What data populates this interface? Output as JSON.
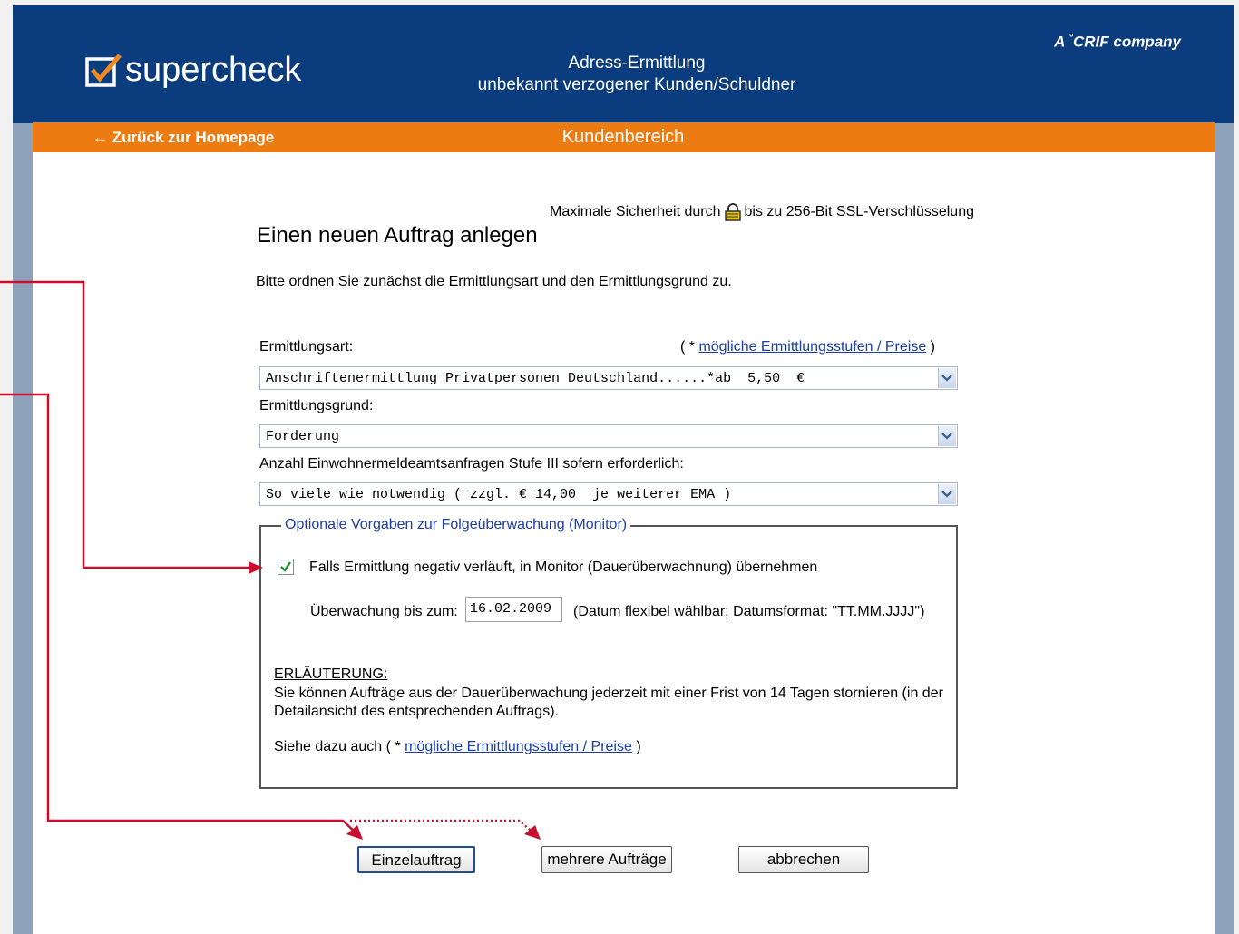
{
  "header": {
    "logo_text": "supercheck",
    "title_line1": "Adress-Ermittlung",
    "title_line2": "unbekannt verzogener Kunden/Schuldner",
    "company": "A CRIF company",
    "company_parts": {
      "a": "A",
      "crif": "CRIF",
      "company": "company"
    }
  },
  "nav": {
    "back_label": "← Zurück zur Homepage",
    "area_title": "Kundenbereich"
  },
  "main": {
    "ssl_pre": "Maximale Sicherheit durch",
    "ssl_post": "bis zu 256-Bit SSL-Verschlüsselung",
    "page_title": "Einen neuen Auftrag anlegen",
    "intro": "Bitte ordnen Sie zunächst die Ermittlungsart und den Ermittlungsgrund zu.",
    "ermittlungsart_label": "Ermittlungsart:",
    "hint_open": "( * ",
    "hint_link": "mögliche Ermittlungsstufen / Preise",
    "hint_close": " )",
    "ermittlungsart_value": "Anschriftenermittlung Privatpersonen Deutschland......*ab  5,50  €",
    "ermittlungsgrund_label": "Ermittlungsgrund:",
    "ermittlungsgrund_value": "Forderung",
    "anzahl_label": "Anzahl Einwohnermeldeamtsanfragen Stufe III sofern erforderlich:",
    "anzahl_value": "So viele wie notwendig ( zzgl. € 14,00  je weiterer EMA )"
  },
  "monitor": {
    "legend": "Optionale Vorgaben zur Folgeüberwachung (Monitor)",
    "checkbox_checked": true,
    "checkbox_label": "Falls Ermittlung negativ verläuft, in Monitor (Dauerüberwachnung) übernehmen",
    "date_label": "Überwachung bis zum:",
    "date_value": "16.02.2009",
    "date_hint": "(Datum flexibel wählbar; Datumsformat: \"TT.MM.JJJJ\")",
    "erl_heading": "ERLÄUTERUNG:",
    "erl_text": "Sie können Aufträge aus der Dauerüberwachung jederzeit mit einer Frist von 14 Tagen stornieren (in der Detailansicht des entsprechenden Auftrags).",
    "siehe_pre": "Siehe dazu auch ( * ",
    "siehe_link": "mögliche Ermittlungsstufen / Preise",
    "siehe_post": " )"
  },
  "buttons": {
    "single": "Einzelauftrag",
    "multiple": "mehrere Aufträge",
    "cancel": "abbrechen"
  },
  "colors": {
    "header_bg": "#0b3c7d",
    "nav_bg": "#ec7b11",
    "link": "#1b3ea8",
    "annotation": "#c8102e"
  }
}
